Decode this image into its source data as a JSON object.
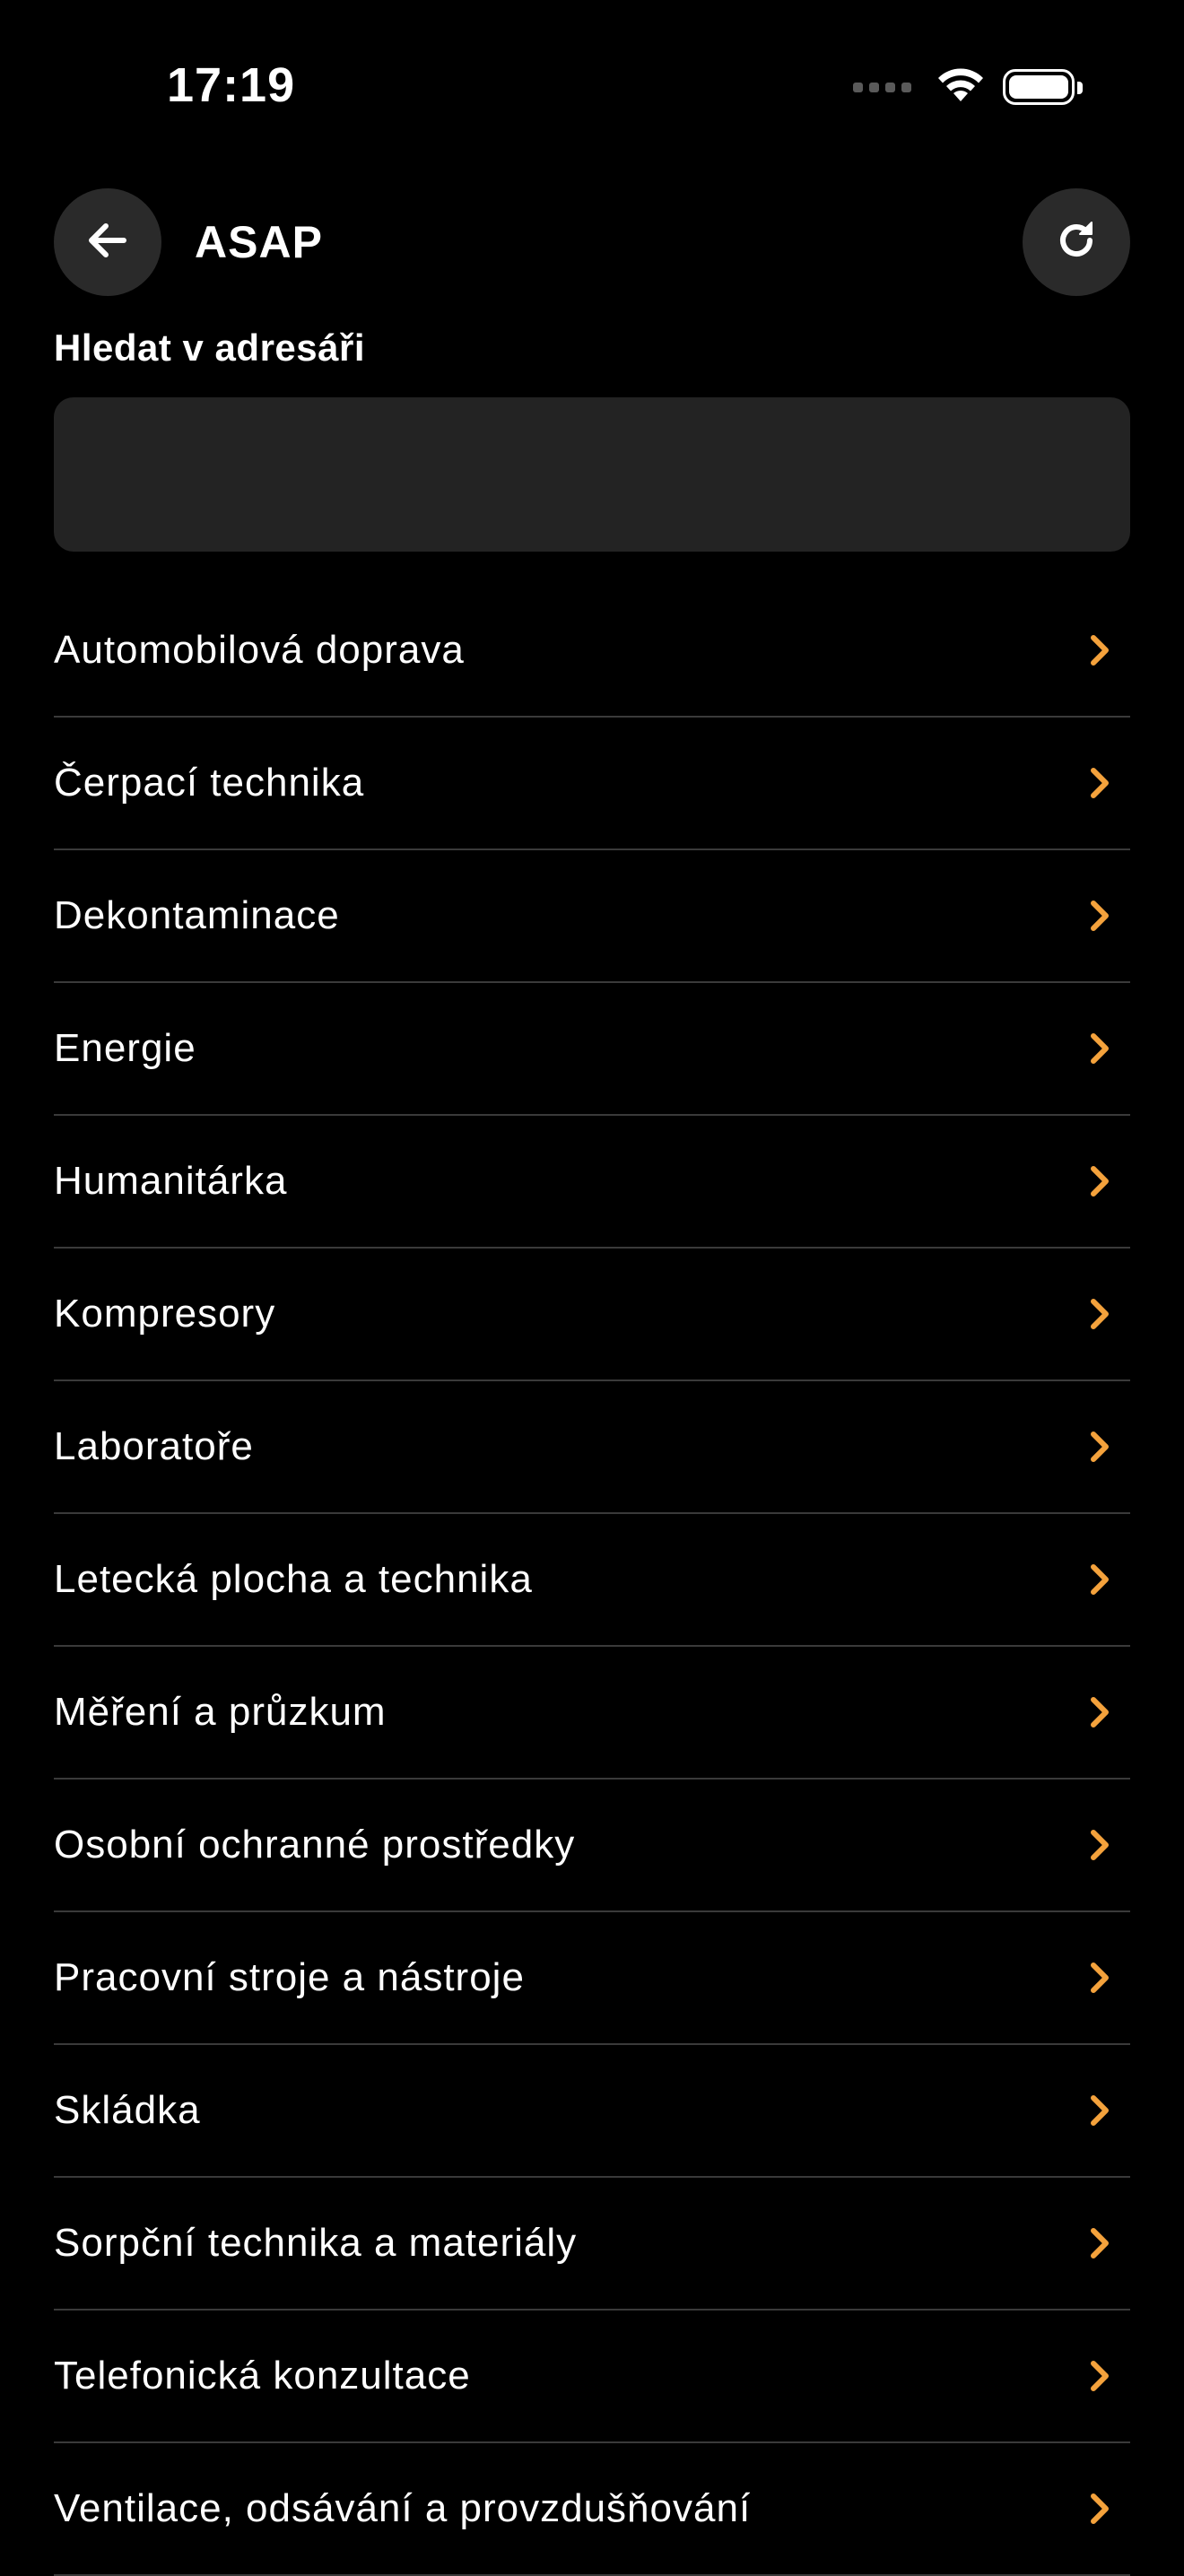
{
  "status_bar": {
    "time": "17:19"
  },
  "header": {
    "title": "ASAP"
  },
  "search": {
    "label": "Hledat v adresáři",
    "value": "",
    "placeholder": ""
  },
  "colors": {
    "accent": "#F4A23C",
    "background": "#000000",
    "surface": "#232323",
    "button": "#2A2A2A",
    "divider": "#3A3A3A"
  },
  "icons": {
    "back": "arrow-left-icon",
    "refresh": "refresh-icon",
    "item_chevron": "chevron-right-icon",
    "wifi": "wifi-icon",
    "battery": "battery-icon"
  },
  "categories": [
    {
      "label": "Automobilová doprava"
    },
    {
      "label": "Čerpací technika"
    },
    {
      "label": "Dekontaminace"
    },
    {
      "label": "Energie"
    },
    {
      "label": "Humanitárka"
    },
    {
      "label": "Kompresory"
    },
    {
      "label": "Laboratoře"
    },
    {
      "label": "Letecká plocha a technika"
    },
    {
      "label": "Měření a průzkum"
    },
    {
      "label": "Osobní ochranné prostředky"
    },
    {
      "label": "Pracovní stroje a nástroje"
    },
    {
      "label": "Skládka"
    },
    {
      "label": "Sorpční technika a materiály"
    },
    {
      "label": "Telefonická konzultace"
    },
    {
      "label": "Ventilace, odsávání a provzdušňování"
    }
  ]
}
